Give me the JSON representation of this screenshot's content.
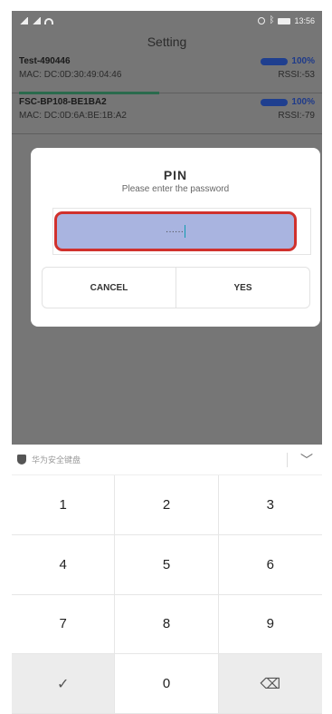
{
  "status_bar": {
    "time": "13:56"
  },
  "app": {
    "title": "Setting",
    "devices": [
      {
        "name": "Test-490446",
        "mac": "MAC: DC:0D:30:49:04:46",
        "battery": "100%",
        "rssi": "RSSI:-53"
      },
      {
        "name": "FSC-BP108-BE1BA2",
        "mac": "MAC: DC:0D:6A:BE:1B:A2",
        "battery": "100%",
        "rssi": "RSSI:-79"
      }
    ]
  },
  "dialog": {
    "title": "PIN",
    "subtitle": "Please enter the password",
    "pin_value": "······",
    "cancel_label": "CANCEL",
    "yes_label": "YES"
  },
  "keyboard": {
    "brand": "华为安全键盘",
    "keys": [
      "1",
      "2",
      "3",
      "4",
      "5",
      "6",
      "7",
      "8",
      "9",
      "✓",
      "0",
      "⌫"
    ]
  },
  "colors": {
    "dim_overlay": "#767676",
    "pin_field_fill": "#a9b4e0",
    "pin_field_border": "#d0312d",
    "battery_pill": "#1f3f8f"
  }
}
